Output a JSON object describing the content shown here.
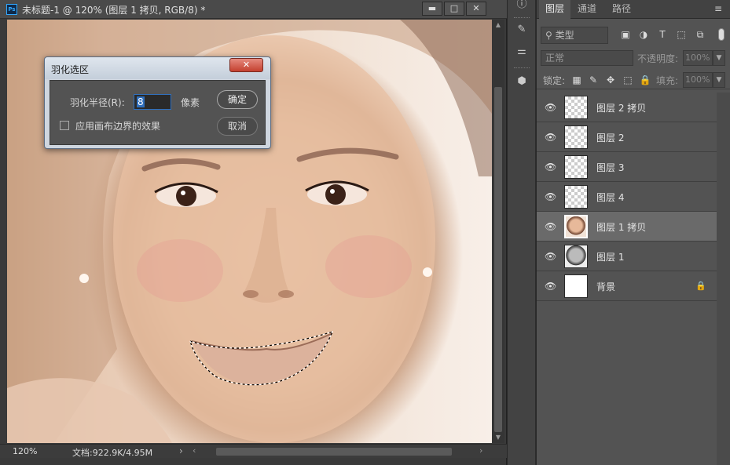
{
  "document": {
    "app_icon": "Ps",
    "title": "未标题-1 @ 120% (图层 1 拷贝, RGB/8) *",
    "window_buttons": {
      "minimize": "▬",
      "maximize": "□",
      "close": "✕"
    },
    "status": {
      "zoom": "120%",
      "doc_size": "文档:922.9K/4.95M",
      "arrow": "›"
    }
  },
  "dialog": {
    "title": "羽化选区",
    "close": "✕",
    "radius_label": "羽化半径(R):",
    "radius_value": "8",
    "unit": "像素",
    "ok": "确定",
    "cancel": "取消",
    "canvas_bounds_label": "应用画布边界的效果",
    "canvas_bounds_checked": false
  },
  "tools": [
    {
      "name": "info-icon",
      "glyph": "ⓘ"
    },
    {
      "name": "brush-preset-icon",
      "glyph": "✎"
    },
    {
      "name": "adjustments-icon",
      "glyph": "⚌"
    },
    {
      "name": "3d-object-icon",
      "glyph": "⬢"
    }
  ],
  "panel": {
    "tabs": [
      "图层",
      "通道",
      "路径"
    ],
    "menu": "≡",
    "filter": {
      "kind": "类型",
      "icons": [
        "image-filter-icon",
        "adjustment-filter-icon",
        "type-filter-icon",
        "shape-filter-icon",
        "smart-object-filter-icon"
      ],
      "icon_glyphs": [
        "▣",
        "◑",
        "T",
        "⬚",
        "⧉"
      ]
    },
    "blend_mode": "正常",
    "opacity_label": "不透明度:",
    "opacity_value": "100%",
    "lock_label": "锁定:",
    "lock_glyphs": [
      "▦",
      "✎",
      "✥",
      "⬚",
      "🔒"
    ],
    "fill_label": "填充:",
    "fill_value": "100%",
    "layers": [
      {
        "name": "图层 2 拷贝",
        "thumb": "transparent"
      },
      {
        "name": "图层 2",
        "thumb": "transparent"
      },
      {
        "name": "图层 3",
        "thumb": "transparent"
      },
      {
        "name": "图层 4",
        "thumb": "transparent"
      },
      {
        "name": "图层 1 拷贝",
        "thumb": "face",
        "selected": true
      },
      {
        "name": "图层 1",
        "thumb": "gray"
      },
      {
        "name": "背景",
        "thumb": "white",
        "locked": true
      }
    ]
  }
}
